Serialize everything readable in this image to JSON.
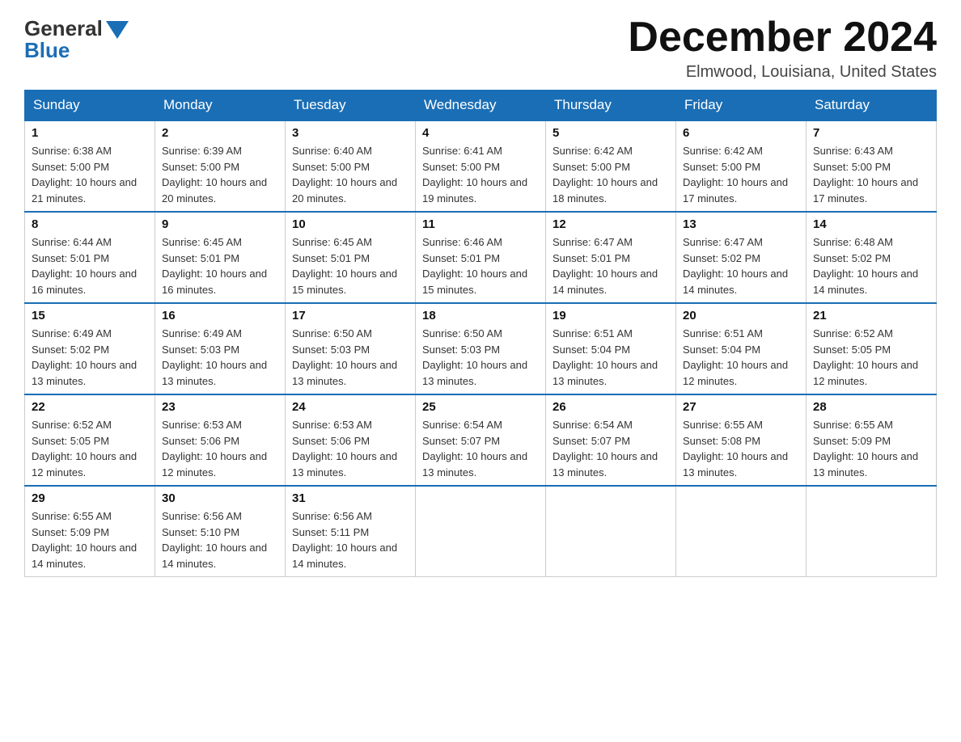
{
  "logo": {
    "general": "General",
    "blue": "Blue"
  },
  "title": "December 2024",
  "location": "Elmwood, Louisiana, United States",
  "days_of_week": [
    "Sunday",
    "Monday",
    "Tuesday",
    "Wednesday",
    "Thursday",
    "Friday",
    "Saturday"
  ],
  "weeks": [
    [
      {
        "day": "1",
        "sunrise": "6:38 AM",
        "sunset": "5:00 PM",
        "daylight": "10 hours and 21 minutes."
      },
      {
        "day": "2",
        "sunrise": "6:39 AM",
        "sunset": "5:00 PM",
        "daylight": "10 hours and 20 minutes."
      },
      {
        "day": "3",
        "sunrise": "6:40 AM",
        "sunset": "5:00 PM",
        "daylight": "10 hours and 20 minutes."
      },
      {
        "day": "4",
        "sunrise": "6:41 AM",
        "sunset": "5:00 PM",
        "daylight": "10 hours and 19 minutes."
      },
      {
        "day": "5",
        "sunrise": "6:42 AM",
        "sunset": "5:00 PM",
        "daylight": "10 hours and 18 minutes."
      },
      {
        "day": "6",
        "sunrise": "6:42 AM",
        "sunset": "5:00 PM",
        "daylight": "10 hours and 17 minutes."
      },
      {
        "day": "7",
        "sunrise": "6:43 AM",
        "sunset": "5:00 PM",
        "daylight": "10 hours and 17 minutes."
      }
    ],
    [
      {
        "day": "8",
        "sunrise": "6:44 AM",
        "sunset": "5:01 PM",
        "daylight": "10 hours and 16 minutes."
      },
      {
        "day": "9",
        "sunrise": "6:45 AM",
        "sunset": "5:01 PM",
        "daylight": "10 hours and 16 minutes."
      },
      {
        "day": "10",
        "sunrise": "6:45 AM",
        "sunset": "5:01 PM",
        "daylight": "10 hours and 15 minutes."
      },
      {
        "day": "11",
        "sunrise": "6:46 AM",
        "sunset": "5:01 PM",
        "daylight": "10 hours and 15 minutes."
      },
      {
        "day": "12",
        "sunrise": "6:47 AM",
        "sunset": "5:01 PM",
        "daylight": "10 hours and 14 minutes."
      },
      {
        "day": "13",
        "sunrise": "6:47 AM",
        "sunset": "5:02 PM",
        "daylight": "10 hours and 14 minutes."
      },
      {
        "day": "14",
        "sunrise": "6:48 AM",
        "sunset": "5:02 PM",
        "daylight": "10 hours and 14 minutes."
      }
    ],
    [
      {
        "day": "15",
        "sunrise": "6:49 AM",
        "sunset": "5:02 PM",
        "daylight": "10 hours and 13 minutes."
      },
      {
        "day": "16",
        "sunrise": "6:49 AM",
        "sunset": "5:03 PM",
        "daylight": "10 hours and 13 minutes."
      },
      {
        "day": "17",
        "sunrise": "6:50 AM",
        "sunset": "5:03 PM",
        "daylight": "10 hours and 13 minutes."
      },
      {
        "day": "18",
        "sunrise": "6:50 AM",
        "sunset": "5:03 PM",
        "daylight": "10 hours and 13 minutes."
      },
      {
        "day": "19",
        "sunrise": "6:51 AM",
        "sunset": "5:04 PM",
        "daylight": "10 hours and 13 minutes."
      },
      {
        "day": "20",
        "sunrise": "6:51 AM",
        "sunset": "5:04 PM",
        "daylight": "10 hours and 12 minutes."
      },
      {
        "day": "21",
        "sunrise": "6:52 AM",
        "sunset": "5:05 PM",
        "daylight": "10 hours and 12 minutes."
      }
    ],
    [
      {
        "day": "22",
        "sunrise": "6:52 AM",
        "sunset": "5:05 PM",
        "daylight": "10 hours and 12 minutes."
      },
      {
        "day": "23",
        "sunrise": "6:53 AM",
        "sunset": "5:06 PM",
        "daylight": "10 hours and 12 minutes."
      },
      {
        "day": "24",
        "sunrise": "6:53 AM",
        "sunset": "5:06 PM",
        "daylight": "10 hours and 13 minutes."
      },
      {
        "day": "25",
        "sunrise": "6:54 AM",
        "sunset": "5:07 PM",
        "daylight": "10 hours and 13 minutes."
      },
      {
        "day": "26",
        "sunrise": "6:54 AM",
        "sunset": "5:07 PM",
        "daylight": "10 hours and 13 minutes."
      },
      {
        "day": "27",
        "sunrise": "6:55 AM",
        "sunset": "5:08 PM",
        "daylight": "10 hours and 13 minutes."
      },
      {
        "day": "28",
        "sunrise": "6:55 AM",
        "sunset": "5:09 PM",
        "daylight": "10 hours and 13 minutes."
      }
    ],
    [
      {
        "day": "29",
        "sunrise": "6:55 AM",
        "sunset": "5:09 PM",
        "daylight": "10 hours and 14 minutes."
      },
      {
        "day": "30",
        "sunrise": "6:56 AM",
        "sunset": "5:10 PM",
        "daylight": "10 hours and 14 minutes."
      },
      {
        "day": "31",
        "sunrise": "6:56 AM",
        "sunset": "5:11 PM",
        "daylight": "10 hours and 14 minutes."
      },
      null,
      null,
      null,
      null
    ]
  ]
}
